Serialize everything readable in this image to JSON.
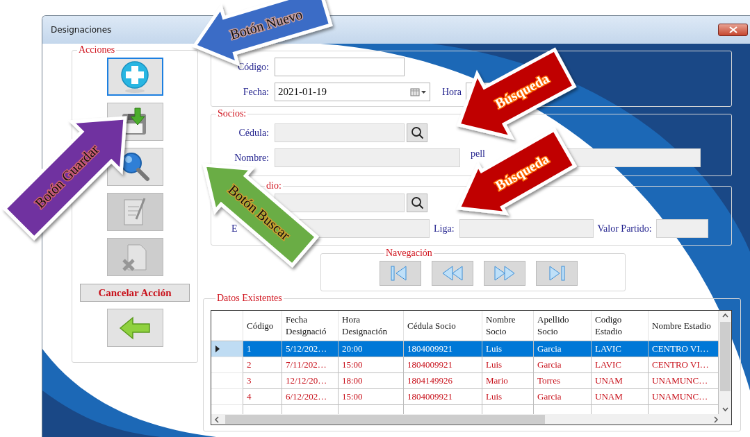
{
  "window": {
    "title": "Designaciones"
  },
  "actions": {
    "legend": "Acciones",
    "items": [
      {
        "kind": "new",
        "disabled": false,
        "focused": true
      },
      {
        "kind": "save",
        "disabled": false,
        "focused": false
      },
      {
        "kind": "search",
        "disabled": false,
        "focused": false
      },
      {
        "kind": "edit",
        "disabled": true,
        "focused": false
      },
      {
        "kind": "delete",
        "disabled": true,
        "focused": false
      },
      {
        "kind": "text",
        "label": "Cancelar Acción",
        "disabled": false,
        "focused": false
      },
      {
        "kind": "back",
        "disabled": false,
        "focused": false
      }
    ]
  },
  "designation": {
    "fields": [
      {
        "label": "Código:",
        "disabled": false
      },
      {
        "label": "Fecha:",
        "value": "2021-01-19",
        "disabled": false
      },
      {
        "label": "Hora",
        "disabled": false
      }
    ]
  },
  "socios": {
    "legend": "Socios:",
    "fields": [
      {
        "label": "Cédula:",
        "disabled": true
      },
      {
        "label": "Nombre:",
        "disabled": true
      },
      {
        "label": "pell",
        "disabled": true
      }
    ]
  },
  "estadio": {
    "legend": "dio:",
    "fields": [
      {
        "disabled": true
      },
      {
        "label": "E",
        "disabled": true
      },
      {
        "label": "Liga:",
        "disabled": true
      },
      {
        "label": "Valor Partido:",
        "disabled": true
      }
    ]
  },
  "navigation": {
    "legend": "Navegación",
    "buttons": [
      {
        "kind": "first"
      },
      {
        "kind": "previous"
      },
      {
        "kind": "next"
      },
      {
        "kind": "last"
      }
    ]
  },
  "table": {
    "legend": "Datos Existentes",
    "columns": [
      "Código",
      "Fecha Designació",
      "Hora Designación",
      "Cédula Socio",
      "Nombre Socio",
      "Apellido Socio",
      "Codigo Estadio",
      "Nombre Estadio"
    ],
    "rows": [
      {
        "selected": true,
        "cells": [
          "1",
          "5/12/202…",
          "20:00",
          "1804009921",
          "Luis",
          "Garcia",
          "LAVIC",
          "CENTRO VI…"
        ]
      },
      {
        "selected": false,
        "cells": [
          "2",
          "7/11/202…",
          "15:00",
          "1804009921",
          "Luis",
          "Garcia",
          "LAVIC",
          "CENTRO VI…"
        ]
      },
      {
        "selected": false,
        "cells": [
          "3",
          "12/12/20…",
          "18:00",
          "1804149926",
          "Mario",
          "Torres",
          "UNAM",
          "UNAMUNC…"
        ]
      },
      {
        "selected": false,
        "cells": [
          "4",
          "6/12/202…",
          "15:00",
          "1804009921",
          "Luis",
          "Garcia",
          "UNAM",
          "UNAMUNC…"
        ]
      }
    ]
  },
  "annotations": [
    {
      "text": "Botón Nuevo",
      "color": "#3a6cc6"
    },
    {
      "text": "Botón Guardar",
      "color": "#7030a0"
    },
    {
      "text": "Botón Buscar",
      "color": "#6aad45"
    },
    {
      "text": "Búsqueda",
      "color": "#c00000"
    },
    {
      "text": "Búsqueda",
      "color": "#c00000"
    }
  ]
}
